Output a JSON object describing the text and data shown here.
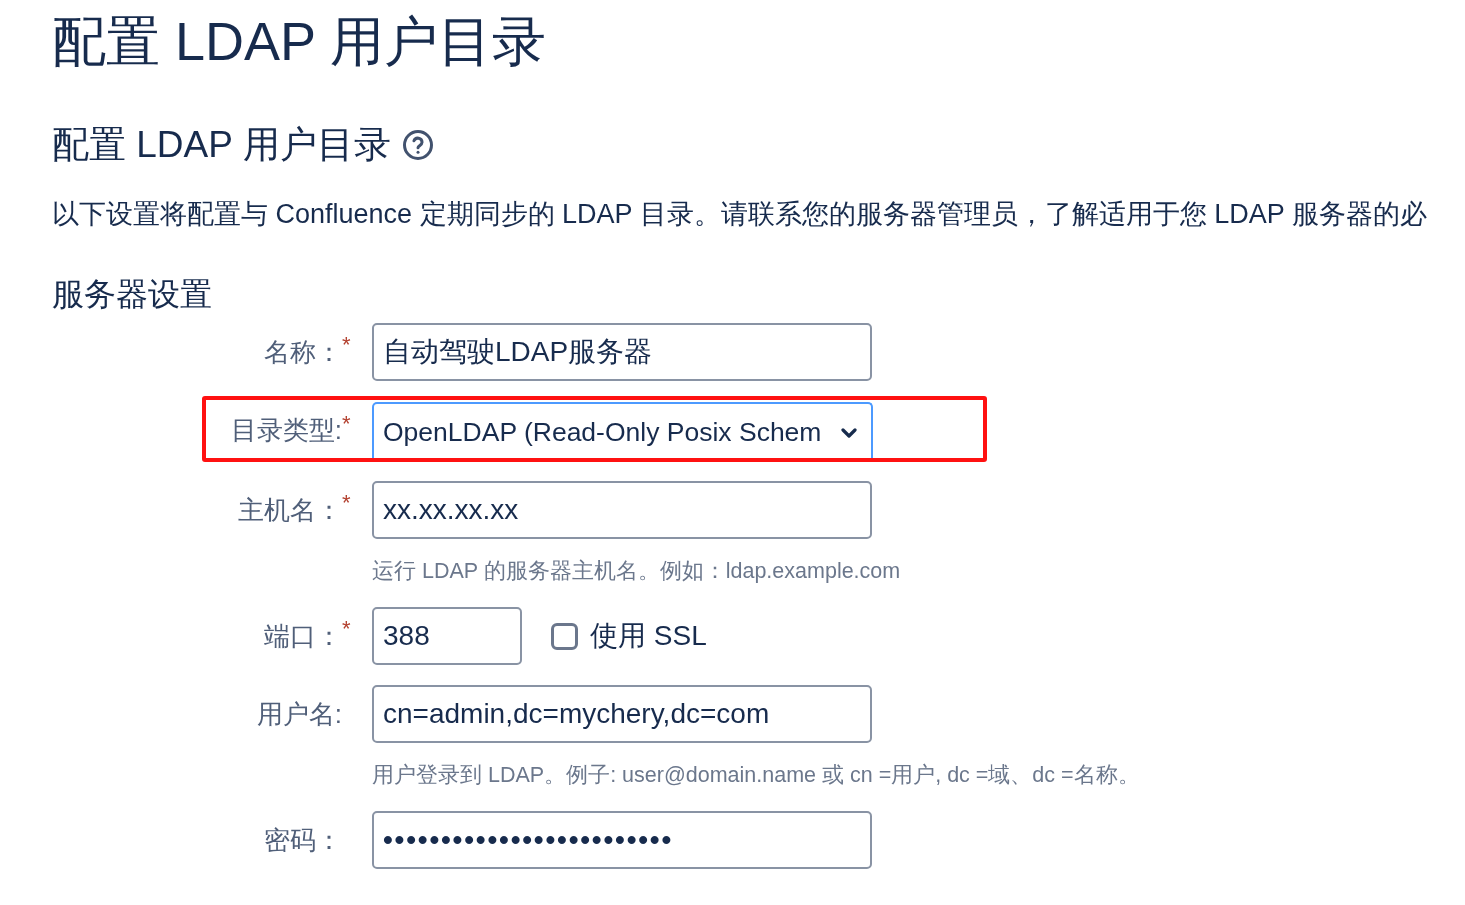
{
  "page_title": "配置 LDAP 用户目录",
  "section": {
    "title": "配置 LDAP 用户目录",
    "description": "以下设置将配置与 Confluence 定期同步的 LDAP 目录。请联系您的服务器管理员，了解适用于您 LDAP 服务器的必"
  },
  "server_settings": {
    "heading": "服务器设置",
    "fields": [
      {
        "kind": "text",
        "label": "名称：",
        "required_mark": "*",
        "value": "自动驾驶LDAP服务器"
      },
      {
        "kind": "select",
        "label": "目录类型:",
        "required_mark": "*",
        "value": "OpenLDAP (Read-Only Posix Schem",
        "focused": true,
        "highlighted": true
      },
      {
        "kind": "text",
        "label": "主机名：",
        "required_mark": "*",
        "value": "xx.xx.xx.xx",
        "hint": "运行 LDAP 的服务器主机名。例如：ldap.example.com"
      },
      {
        "kind": "port",
        "label": "端口：",
        "required_mark": "*",
        "value": "388",
        "checkbox": {
          "label": "使用 SSL",
          "checked": false
        }
      },
      {
        "kind": "text",
        "label": "用户名:",
        "value": "cn=admin,dc=mychery,dc=com",
        "hint": "用户登录到 LDAP。例子: user@domain.name 或 cn =用户, dc =域、dc =名称。"
      },
      {
        "kind": "password",
        "label": "密码：",
        "value": "•••••••••••••••••••••••••"
      }
    ]
  }
}
